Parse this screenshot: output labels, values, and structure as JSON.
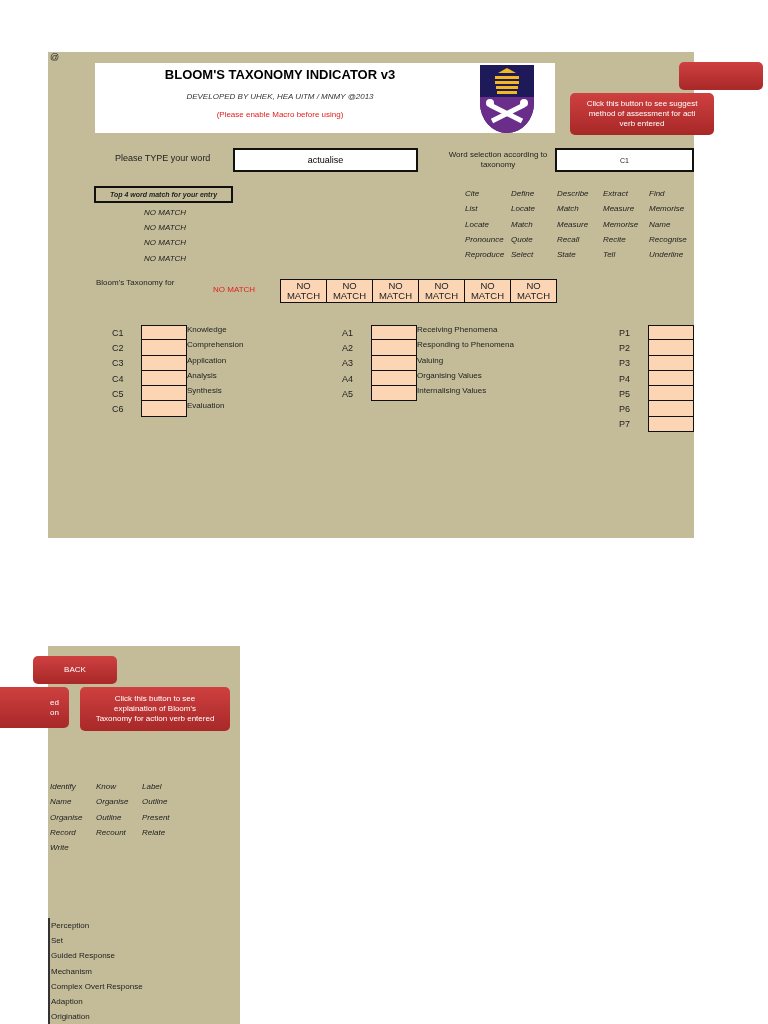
{
  "corner_mark": "@",
  "header": {
    "title": "BLOOM'S TAXONOMY INDICATOR v3",
    "subtitle": "DEVELOPED BY UHEK, HEA UiTM / MNMY @2013",
    "notice": "(Please enable Macro before using)"
  },
  "assessment_button": {
    "lines": [
      "Click this button to see suggest",
      "method of assessment for acti",
      "verb entered"
    ]
  },
  "word_entry": {
    "label": "Please TYPE your word",
    "value": "actualise"
  },
  "selection": {
    "label": "Word selection according to taxonomy",
    "value": "C1"
  },
  "matches": {
    "title": "Top 4 word match for your entry",
    "items": [
      "NO MATCH",
      "NO MATCH",
      "NO MATCH",
      "NO MATCH"
    ]
  },
  "word_grid": [
    [
      "Cite",
      "Define",
      "Describe",
      "Extract",
      "Find"
    ],
    [
      "List",
      "Locate",
      "Match",
      "Measure",
      "Memorise"
    ],
    [
      "Locate",
      "Match",
      "Measure",
      "Memorise",
      "Name"
    ],
    [
      "Pronounce",
      "Quote",
      "Recall",
      "Recite",
      "Recognise"
    ],
    [
      "Reproduce",
      "Select",
      "State",
      "Tell",
      "Underline"
    ]
  ],
  "taxonomy_for": {
    "label": "Bloom's Taxonomy for",
    "value": "NO MATCH",
    "cells": [
      "NO MATCH",
      "NO MATCH",
      "NO MATCH",
      "NO MATCH",
      "NO MATCH",
      "NO MATCH"
    ]
  },
  "cognitive": [
    {
      "code": "C1",
      "name": "Knowledge"
    },
    {
      "code": "C2",
      "name": "Comprehension"
    },
    {
      "code": "C3",
      "name": "Application"
    },
    {
      "code": "C4",
      "name": "Analysis"
    },
    {
      "code": "C5",
      "name": "Synthesis"
    },
    {
      "code": "C6",
      "name": "Evaluation"
    }
  ],
  "affective": [
    {
      "code": "A1",
      "name": "Receiving Phenomena"
    },
    {
      "code": "A2",
      "name": "Responding to Phenomena"
    },
    {
      "code": "A3",
      "name": "Valuing"
    },
    {
      "code": "A4",
      "name": "Organising Values"
    },
    {
      "code": "A5",
      "name": "Internalising Values"
    }
  ],
  "psychomotor": [
    {
      "code": "P1"
    },
    {
      "code": "P2"
    },
    {
      "code": "P3"
    },
    {
      "code": "P4"
    },
    {
      "code": "P5"
    },
    {
      "code": "P6"
    },
    {
      "code": "P7"
    }
  ],
  "second_sheet": {
    "back_button": "BACK",
    "partial_button": [
      "ed",
      "on"
    ],
    "explain_button": [
      "Click this button to see",
      "explaination  of Bloom's",
      "Taxonomy for action verb entered"
    ],
    "word_grid": [
      [
        "Identify",
        "Know",
        "Label"
      ],
      [
        "Name",
        "Organise",
        "Outline"
      ],
      [
        "Organise",
        "Outline",
        "Present"
      ],
      [
        "Record",
        "Recount",
        "Relate"
      ],
      [
        "Write"
      ]
    ],
    "psychomotor_names": [
      "Perception",
      "Set",
      "Guided Response",
      "Mechanism",
      "Complex Overt Response",
      "Adaption",
      "Origination"
    ]
  }
}
